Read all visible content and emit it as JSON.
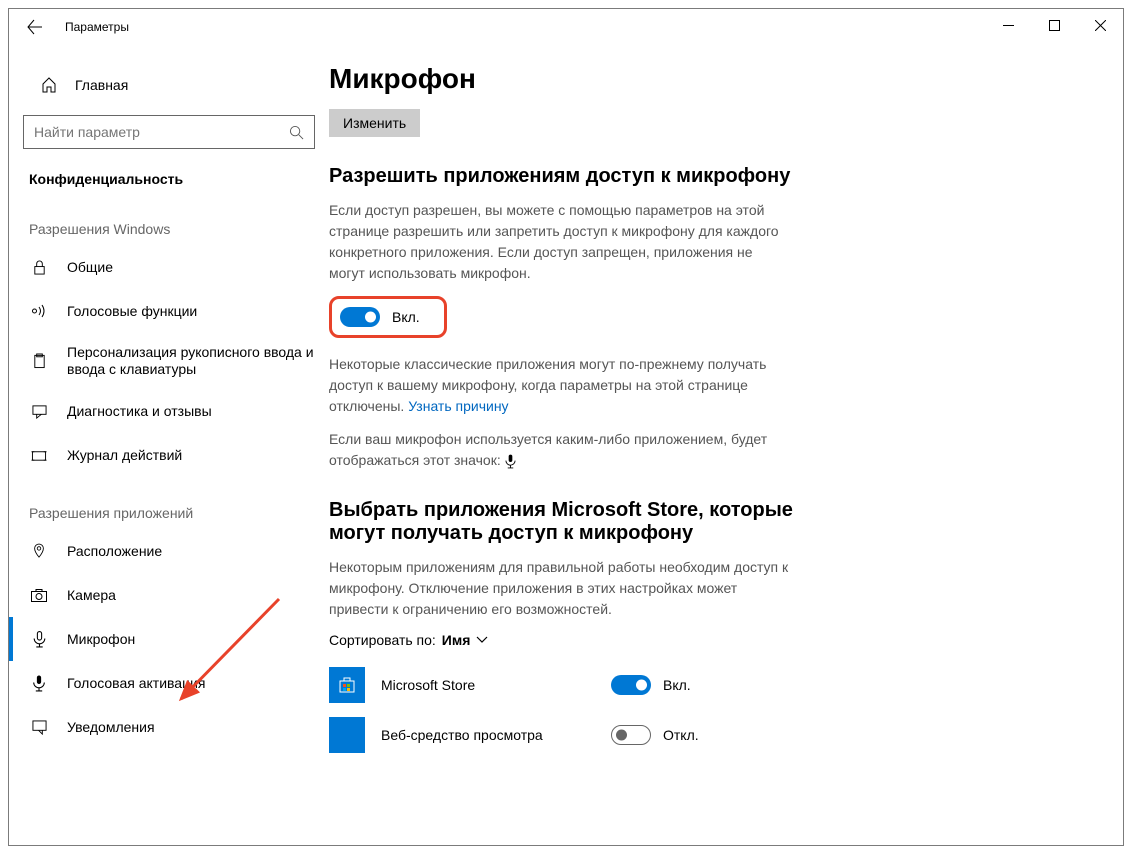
{
  "window": {
    "title": "Параметры"
  },
  "sidebar": {
    "home": "Главная",
    "search_placeholder": "Найти параметр",
    "category": "Конфиденциальность",
    "group1": "Разрешения Windows",
    "group1_items": [
      "Общие",
      "Голосовые функции",
      "Персонализация рукописного ввода и ввода с клавиатуры",
      "Диагностика и отзывы",
      "Журнал действий"
    ],
    "group2": "Разрешения приложений",
    "group2_items": [
      "Расположение",
      "Камера",
      "Микрофон",
      "Голосовая активация",
      "Уведомления"
    ]
  },
  "main": {
    "title": "Микрофон",
    "change_btn": "Изменить",
    "h2a": "Разрешить приложениям доступ к микрофону",
    "desc1": "Если доступ разрешен, вы можете с помощью параметров на этой странице разрешить или запретить доступ к микрофону для каждого конкретного приложения. Если доступ запрещен, приложения не могут использовать микрофон.",
    "toggle_on": "Вкл.",
    "toggle_off": "Откл.",
    "desc2a": "Некоторые классические приложения могут по-прежнему получать доступ к вашему микрофону, когда параметры на этой странице отключены. ",
    "learn_why": "Узнать причину",
    "desc3": "Если ваш микрофон используется каким-либо приложением, будет отображаться этот значок:",
    "h2b": "Выбрать приложения Microsoft Store, которые могут получать доступ к микрофону",
    "desc4": "Некоторым приложениям для правильной работы необходим доступ к микрофону. Отключение приложения в этих настройках может привести к ограничению его возможностей.",
    "sort_label": "Сортировать по:",
    "sort_value": "Имя",
    "apps": [
      {
        "name": "Microsoft Store",
        "on": true
      },
      {
        "name": "Веб-средство просмотра",
        "on": false
      }
    ]
  }
}
